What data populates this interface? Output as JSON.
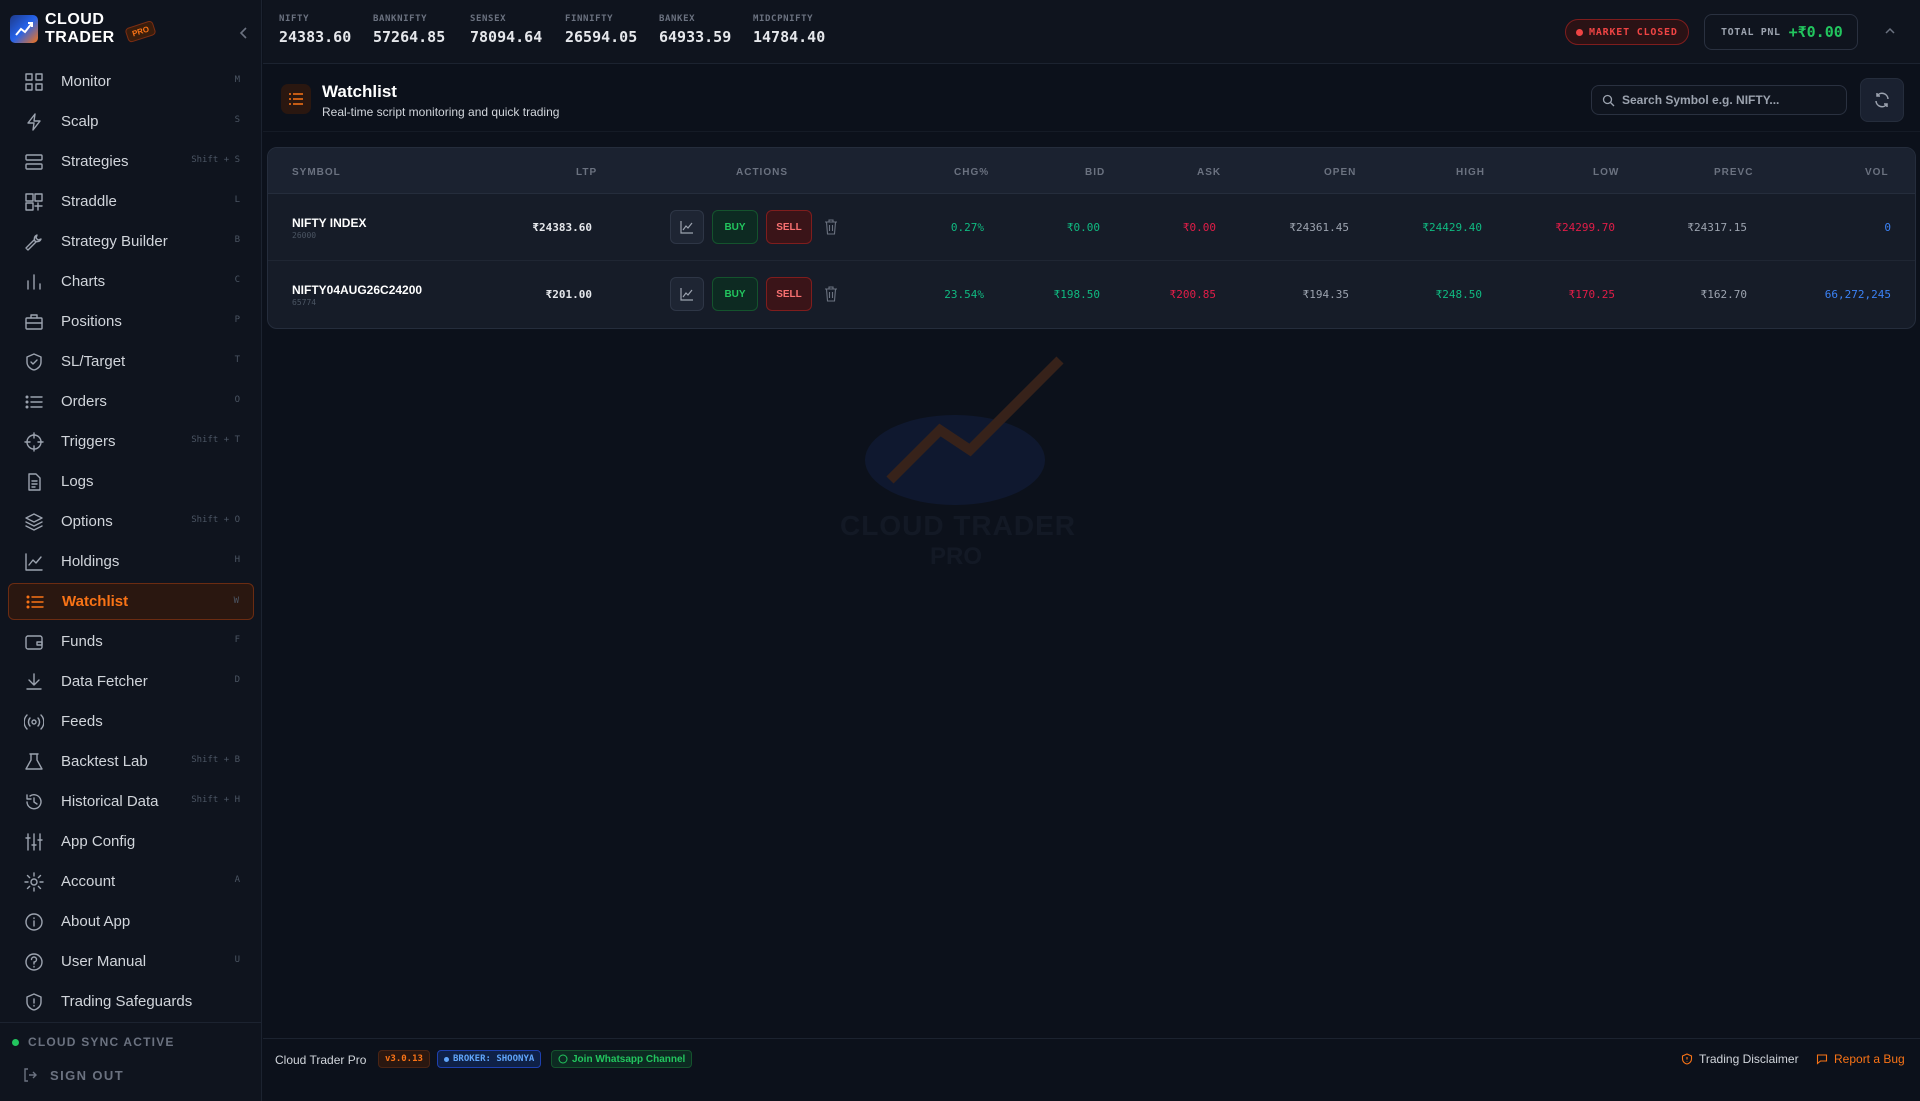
{
  "app": {
    "brand_line1": "CLOUD",
    "brand_line2": "TRADER",
    "brand_badge": "PRO",
    "accent_color": "#f97316"
  },
  "sidebar": {
    "items": [
      {
        "label": "Monitor",
        "key": "M",
        "icon": "grid-icon"
      },
      {
        "label": "Scalp",
        "key": "S",
        "icon": "lightning-icon"
      },
      {
        "label": "Strategies",
        "key": "Shift + S",
        "icon": "server-icon"
      },
      {
        "label": "Straddle",
        "key": "L",
        "icon": "layout-icon"
      },
      {
        "label": "Strategy Builder",
        "key": "B",
        "icon": "wrench-icon"
      },
      {
        "label": "Charts",
        "key": "C",
        "icon": "bar-chart-icon"
      },
      {
        "label": "Positions",
        "key": "P",
        "icon": "briefcase-icon"
      },
      {
        "label": "SL/Target",
        "key": "T",
        "icon": "shield-check-icon"
      },
      {
        "label": "Orders",
        "key": "O",
        "icon": "list-icon"
      },
      {
        "label": "Triggers",
        "key": "Shift + T",
        "icon": "crosshair-icon"
      },
      {
        "label": "Logs",
        "key": "",
        "icon": "file-text-icon"
      },
      {
        "label": "Options",
        "key": "Shift + O",
        "icon": "layers-icon"
      },
      {
        "label": "Holdings",
        "key": "H",
        "icon": "line-chart-icon"
      },
      {
        "label": "Watchlist",
        "key": "W",
        "icon": "list-icon",
        "active": true
      },
      {
        "label": "Funds",
        "key": "F",
        "icon": "wallet-icon"
      },
      {
        "label": "Data Fetcher",
        "key": "D",
        "icon": "download-icon"
      },
      {
        "label": "Feeds",
        "key": "",
        "icon": "broadcast-icon"
      },
      {
        "label": "Backtest Lab",
        "key": "Shift + B",
        "icon": "flask-icon"
      },
      {
        "label": "Historical Data",
        "key": "Shift + H",
        "icon": "history-icon"
      },
      {
        "label": "App Config",
        "key": "",
        "icon": "sliders-icon"
      },
      {
        "label": "Account",
        "key": "A",
        "icon": "gear-icon"
      },
      {
        "label": "About App",
        "key": "",
        "icon": "info-icon"
      },
      {
        "label": "User Manual",
        "key": "U",
        "icon": "help-icon"
      },
      {
        "label": "Trading Safeguards",
        "key": "",
        "icon": "shield-alert-icon"
      }
    ],
    "sync_status": "CLOUD SYNC ACTIVE",
    "sign_out": "SIGN OUT"
  },
  "tickers": [
    {
      "name": "NIFTY",
      "value": "24383.60"
    },
    {
      "name": "BANKNIFTY",
      "value": "57264.85"
    },
    {
      "name": "SENSEX",
      "value": "78094.64"
    },
    {
      "name": "FINNIFTY",
      "value": "26594.05"
    },
    {
      "name": "BANKEX",
      "value": "64933.59"
    },
    {
      "name": "MIDCPNIFTY",
      "value": "14784.40"
    }
  ],
  "topbar": {
    "market_status": "MARKET CLOSED",
    "pnl_label": "TOTAL PNL",
    "pnl_value": "+₹0.00"
  },
  "page": {
    "title": "Watchlist",
    "subtitle": "Real-time script monitoring and quick trading",
    "search_placeholder": "Search Symbol e.g. NIFTY..."
  },
  "table": {
    "headers": {
      "symbol": "SYMBOL",
      "ltp": "LTP",
      "actions": "ACTIONS",
      "chg": "CHG%",
      "bid": "BID",
      "ask": "ASK",
      "open": "OPEN",
      "high": "HIGH",
      "low": "LOW",
      "prevc": "PREVC",
      "vol": "VOL"
    },
    "buy_label": "BUY",
    "sell_label": "SELL",
    "rows": [
      {
        "symbol": "NIFTY INDEX",
        "token": "26000",
        "ltp": "₹24383.60",
        "chg": "0.27%",
        "bid": "₹0.00",
        "ask": "₹0.00",
        "open": "₹24361.45",
        "high": "₹24429.40",
        "low": "₹24299.70",
        "prevc": "₹24317.15",
        "vol": "0"
      },
      {
        "symbol": "NIFTY04AUG26C24200",
        "token": "65774",
        "ltp": "₹201.00",
        "chg": "23.54%",
        "bid": "₹198.50",
        "ask": "₹200.85",
        "open": "₹194.35",
        "high": "₹248.50",
        "low": "₹170.25",
        "prevc": "₹162.70",
        "vol": "66,272,245"
      }
    ]
  },
  "watermark": {
    "line1": "CLOUD TRADER",
    "line2": "PRO"
  },
  "footer": {
    "app_name": "Cloud Trader Pro",
    "version": "v3.0.13",
    "broker": "BROKER: SHOONYA",
    "whatsapp": "Join Whatsapp Channel",
    "disclaimer": "Trading Disclaimer",
    "bug": "Report a Bug"
  }
}
